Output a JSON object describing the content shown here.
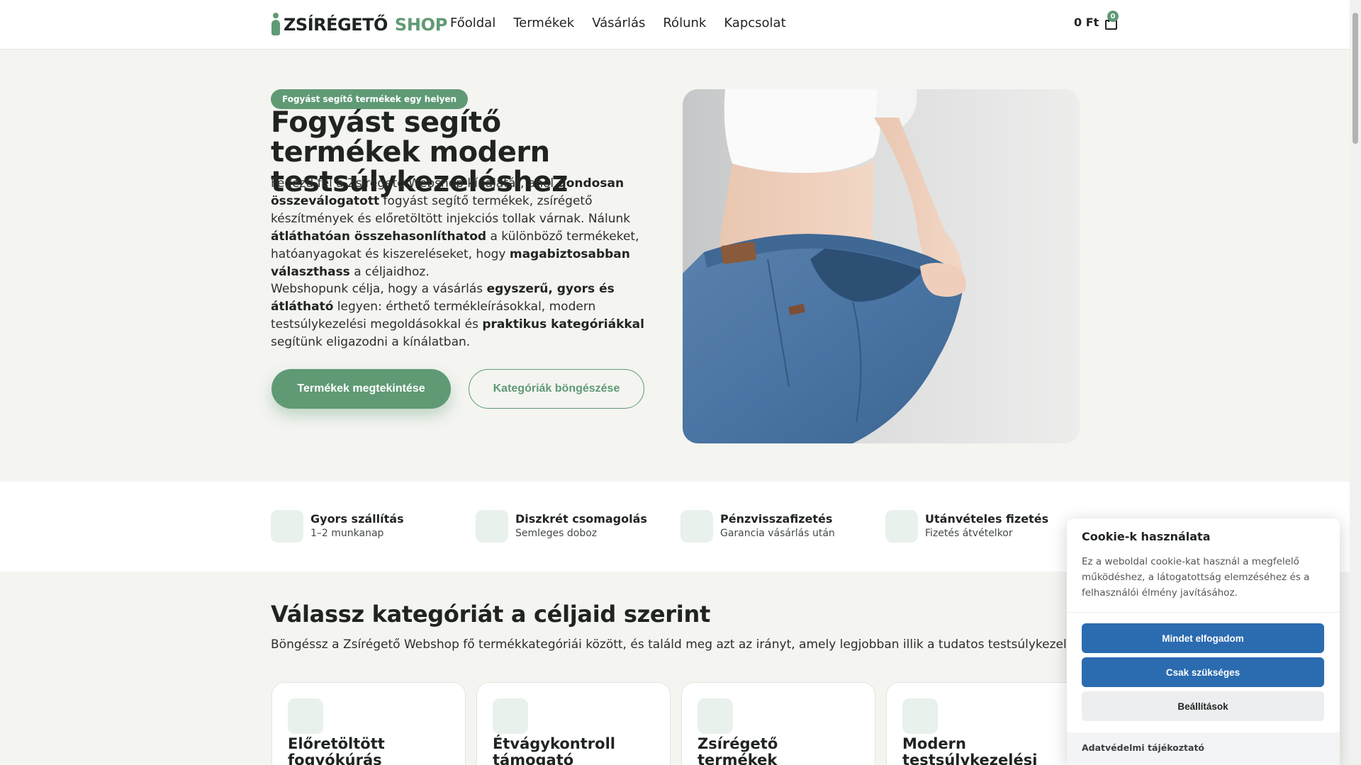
{
  "header": {
    "logo_main": "ZSÍRÉGETŐ",
    "logo_shop": "SHOP",
    "nav": [
      "Főoldal",
      "Termékek",
      "Vásárlás",
      "Rólunk",
      "Kapcsolat"
    ],
    "cart_total": "0 Ft",
    "cart_count": "0"
  },
  "hero": {
    "badge": "Fogyást segítő termékek egy helyen",
    "title": "Fogyást segítő termékek modern testsúlykezeléshez",
    "p1": [
      {
        "t": "Fedezd fel a Zsírégető Webshop kínálatát, ahol ",
        "b": false
      },
      {
        "t": "gondosan összeválogatott",
        "b": true
      },
      {
        "t": " fogyást segítő termékek, zsírégető készítmények és előretöltött injekciós tollak várnak. Nálunk ",
        "b": false
      },
      {
        "t": "átláthatóan összehasonlíthatod",
        "b": true
      },
      {
        "t": " a különböző termékeket, hatóanyagokat és kiszereléseket, hogy ",
        "b": false
      },
      {
        "t": "magabiztosabban választhass",
        "b": true
      },
      {
        "t": " a céljaidhoz.",
        "b": false
      }
    ],
    "p2": [
      {
        "t": "Webshopunk célja, hogy a vásárlás ",
        "b": false
      },
      {
        "t": "egyszerű, gyors és átlátható",
        "b": true
      },
      {
        "t": " legyen: érthető termékleírásokkal, modern testsúlykezelési megoldásokkal és ",
        "b": false
      },
      {
        "t": "praktikus kategóriákkal",
        "b": true
      },
      {
        "t": " segítünk eligazodni a kínálatban.",
        "b": false
      }
    ],
    "primary_button": "Termékek megtekintése",
    "secondary_button": "Kategóriák böngészése"
  },
  "features": [
    {
      "title": "Gyors szállítás",
      "sub": "1–2 munkanap"
    },
    {
      "title": "Diszkrét csomagolás",
      "sub": "Semleges doboz"
    },
    {
      "title": "Pénzvisszafizetés",
      "sub": "Garancia vásárlás után"
    },
    {
      "title": "Utánvételes fizetés",
      "sub": "Fizetés átvételkor"
    }
  ],
  "categories": {
    "title": "Válassz kategóriát a céljaid szerint",
    "subtitle": "Böngéssz a Zsírégető Webshop fő termékkategóriái között, és találd meg azt az irányt, amely legjobban illik a tudatos testsúlykezelésedhez.",
    "items": [
      "Előretöltött fogyókúrás injekciós",
      "Étvágykontroll támogató",
      "Zsírégető termékek életmódváltás mellé",
      "Modern testsúlykezelési"
    ]
  },
  "cookie": {
    "title": "Cookie-k használata",
    "text": "Ez a weboldal cookie-kat használ a megfelelő működéshez, a látogatottság elemzéséhez és a felhasználói élmény javításához.",
    "accept_all": "Mindet elfogadom",
    "necessary": "Csak szükséges",
    "settings": "Beállítások",
    "privacy_link": "Adatvédelmi tájékoztató"
  },
  "colors": {
    "brand_green": "#5f9a75",
    "cookie_blue": "#2b6bb0",
    "hero_bg": "#f4f4f1"
  }
}
